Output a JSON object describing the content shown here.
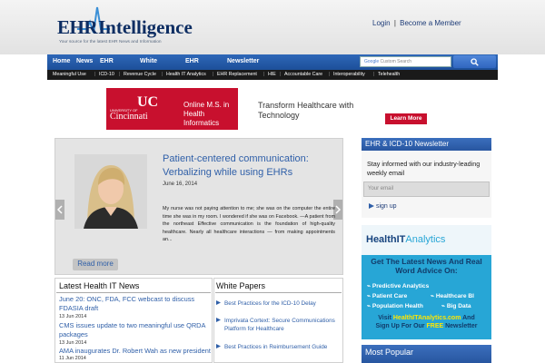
{
  "header": {
    "logo_ehr": "EHR",
    "logo_intelligence": "Intelligence",
    "tagline": "Your source for the latest EHR News and Information",
    "login": "Login",
    "separator": "|",
    "become_member": "Become a Member"
  },
  "nav": {
    "items": [
      "Home",
      "News",
      "EHR",
      "White",
      "EHR",
      "Newsletter"
    ],
    "search_brand": "Google",
    "search_placeholder": "Custom Search"
  },
  "subnav": {
    "items": [
      "Meaningful Use",
      "ICD-10",
      "Revenue Cycle",
      "Health IT Analytics",
      "EHR Replacement",
      "HIE",
      "Accountable Care",
      "Interoperability",
      "Telehealth"
    ]
  },
  "ad": {
    "uc_small": "UNIVERSITY OF",
    "uc_name": "Cincinnati",
    "online": "Online M.S. in Health Informatics",
    "tagline": "Transform Healthcare with Technology",
    "cta": "Learn More"
  },
  "slider": {
    "title": "Patient-centered communication: Verbalizing while using EHRs",
    "date": "June 16, 2014",
    "body": "My nurse was not paying attention to me; she was on the computer the entire time she was in my room. I wondered if she was on Facebook. —A patient from the northeast Effective communication is the foundation of high-quality healthcare. Nearly all healthcare interactions — from making appointments an...",
    "read_more": "Read more"
  },
  "newsletter": {
    "heading": "EHR & ICD-10 Newsletter",
    "text": "Stay informed with our industry-leading weekly email",
    "email_placeholder": "Your email",
    "signup": "sign up"
  },
  "healthit_ad": {
    "brand_a": "HealthIT",
    "brand_b": "Analytics",
    "headline": "Get The Latest News And Real Word Advice On:",
    "features": [
      "Predictive Analytics",
      "Patient Care",
      "Healthcare BI",
      "Population Health",
      "Big Data"
    ],
    "visit_line1_a": "Visit ",
    "visit_site": "HealthITAnalytics.com",
    "visit_line1_b": " And",
    "visit_line2_a": "Sign Up For Our ",
    "visit_free": "FREE",
    "visit_line2_b": " Newsletter"
  },
  "most_popular": {
    "heading": "Most Popular"
  },
  "latest_news": {
    "heading": "Latest Health IT News",
    "items": [
      {
        "text": "June 20: ONC, FDA, FCC webcast to discuss FDASIA draft",
        "date": "13 Jun 2014"
      },
      {
        "text": "CMS issues update to two meaningful use QRDA packages",
        "date": "13 Jun 2014"
      },
      {
        "text": "AMA inaugurates Dr. Robert Wah as new president",
        "date": "11 Jun 2014"
      }
    ]
  },
  "white_papers": {
    "heading": "White Papers",
    "items": [
      "Best Practices for the ICD-10 Delay",
      "Imprivata Cortext: Secure Communications Platform for Healthcare",
      "Best Practices in Reimbursement Guide"
    ]
  },
  "colors": {
    "brand_blue": "#2e67b8",
    "link_blue": "#2f5fa8",
    "uc_red": "#c8102e",
    "healthit_cyan": "#27a6d6"
  }
}
